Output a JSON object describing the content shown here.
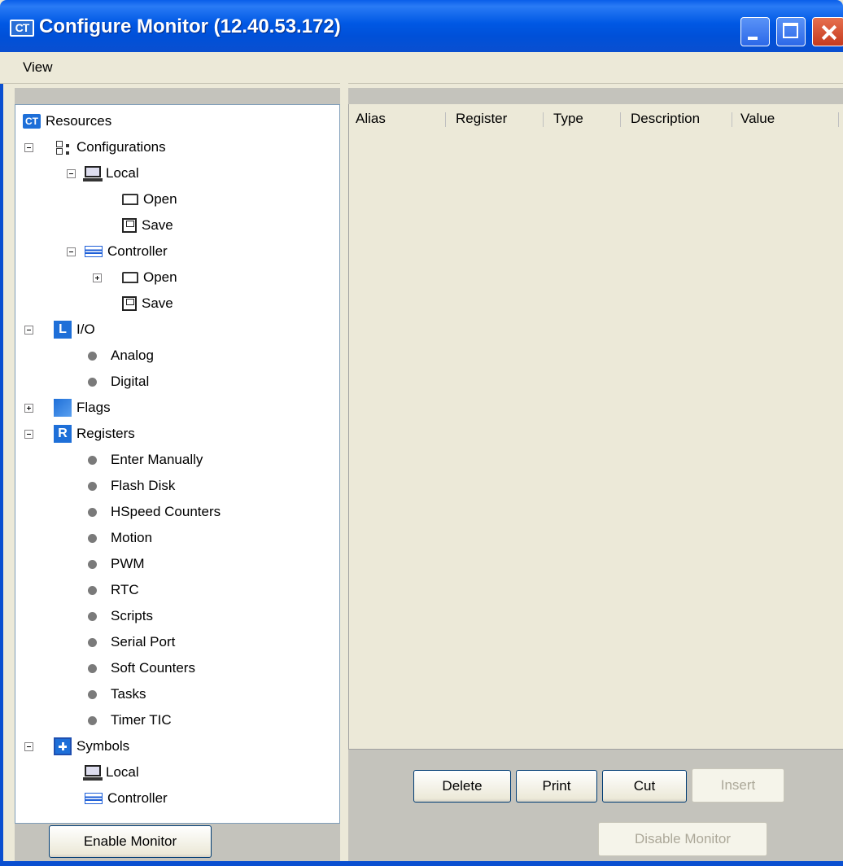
{
  "window": {
    "title": "Configure Monitor (12.40.53.172)",
    "icon_text": "CT"
  },
  "menu": {
    "items": [
      "View"
    ]
  },
  "tree": {
    "root": "Resources",
    "configurations": "Configurations",
    "local": "Local",
    "local_open": "Open",
    "local_save": "Save",
    "controller": "Controller",
    "controller_open": "Open",
    "controller_save": "Save",
    "io": "I/O",
    "analog": "Analog",
    "digital": "Digital",
    "flags": "Flags",
    "registers": "Registers",
    "registers_icon_letter": "R",
    "register_items": [
      "Enter Manually",
      "Flash Disk",
      "HSpeed Counters",
      "Motion",
      "PWM",
      "RTC",
      "Scripts",
      "Serial Port",
      "Soft Counters",
      "Tasks",
      "Timer TIC"
    ],
    "symbols": "Symbols",
    "symbols_local": "Local",
    "symbols_controller": "Controller"
  },
  "grid": {
    "columns": [
      "Alias",
      "Register",
      "Type",
      "Description",
      "Value"
    ]
  },
  "buttons": {
    "enable_monitor": "Enable Monitor",
    "delete": "Delete",
    "print": "Print",
    "cut": "Cut",
    "insert": "Insert",
    "disable_monitor": "Disable Monitor"
  }
}
